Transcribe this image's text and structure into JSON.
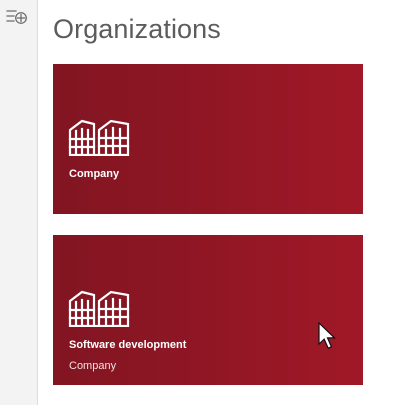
{
  "navigation": {
    "toggle_icon": "navigation-pane-icon"
  },
  "page": {
    "title": "Organizations"
  },
  "tiles": [
    {
      "title": "Company",
      "subtitle": "",
      "icon": "buildings-icon",
      "background_start": "#811521",
      "background_end": "#a01827"
    },
    {
      "title": "Software development",
      "subtitle": "Company",
      "icon": "buildings-icon",
      "background_start": "#811521",
      "background_end": "#a01827"
    }
  ],
  "colors": {
    "rail_background": "#f3f3f3",
    "title_text": "#5c5c5c",
    "tile_text": "#ffffff"
  }
}
